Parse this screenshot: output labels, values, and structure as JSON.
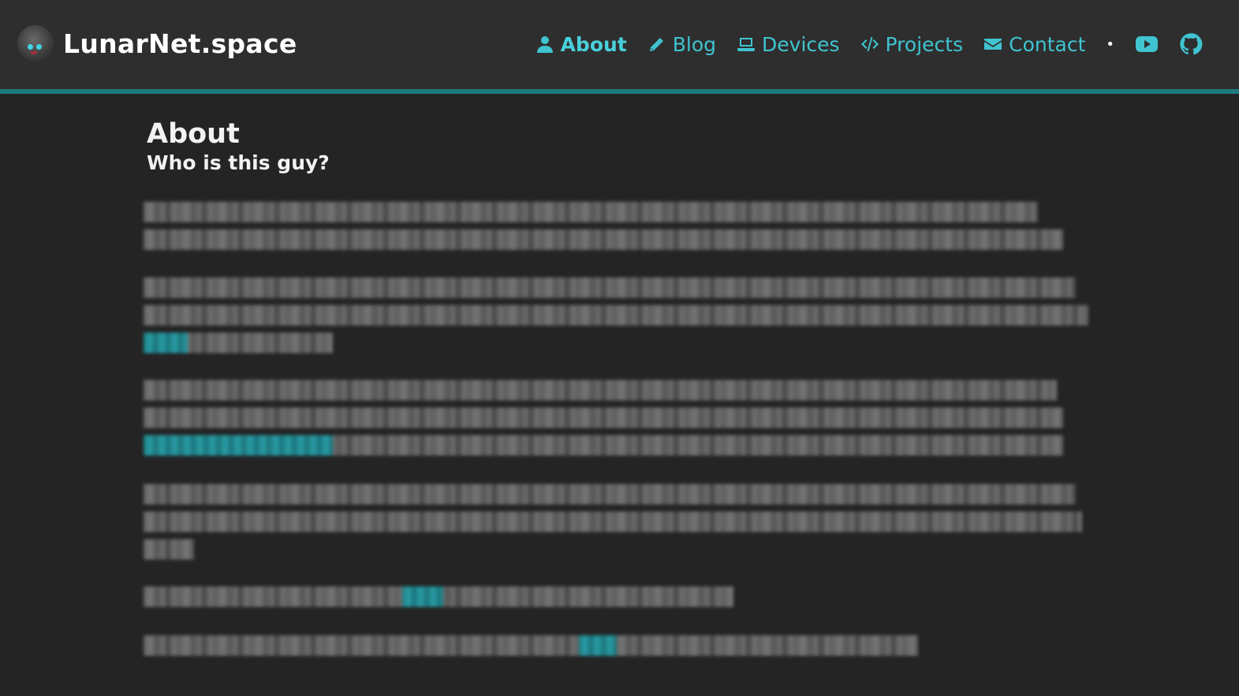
{
  "header": {
    "site_title": "LunarNet.space",
    "logo_icon": "moon-mascot-icon"
  },
  "nav": {
    "items": [
      {
        "label": "About",
        "icon": "user-icon",
        "active": true
      },
      {
        "label": "Blog",
        "icon": "pencil-icon"
      },
      {
        "label": "Devices",
        "icon": "laptop-icon"
      },
      {
        "label": "Projects",
        "icon": "code-icon"
      },
      {
        "label": "Contact",
        "icon": "envelope-icon"
      }
    ],
    "separator": "•",
    "social": [
      {
        "icon": "youtube-icon"
      },
      {
        "icon": "github-icon"
      }
    ]
  },
  "main": {
    "title": "About",
    "subtitle": "Who is this guy?"
  },
  "colors": {
    "accent": "#3fc4d0",
    "header_bg": "#2e2e2e",
    "page_bg": "#242424",
    "header_border": "#1f7a80"
  }
}
